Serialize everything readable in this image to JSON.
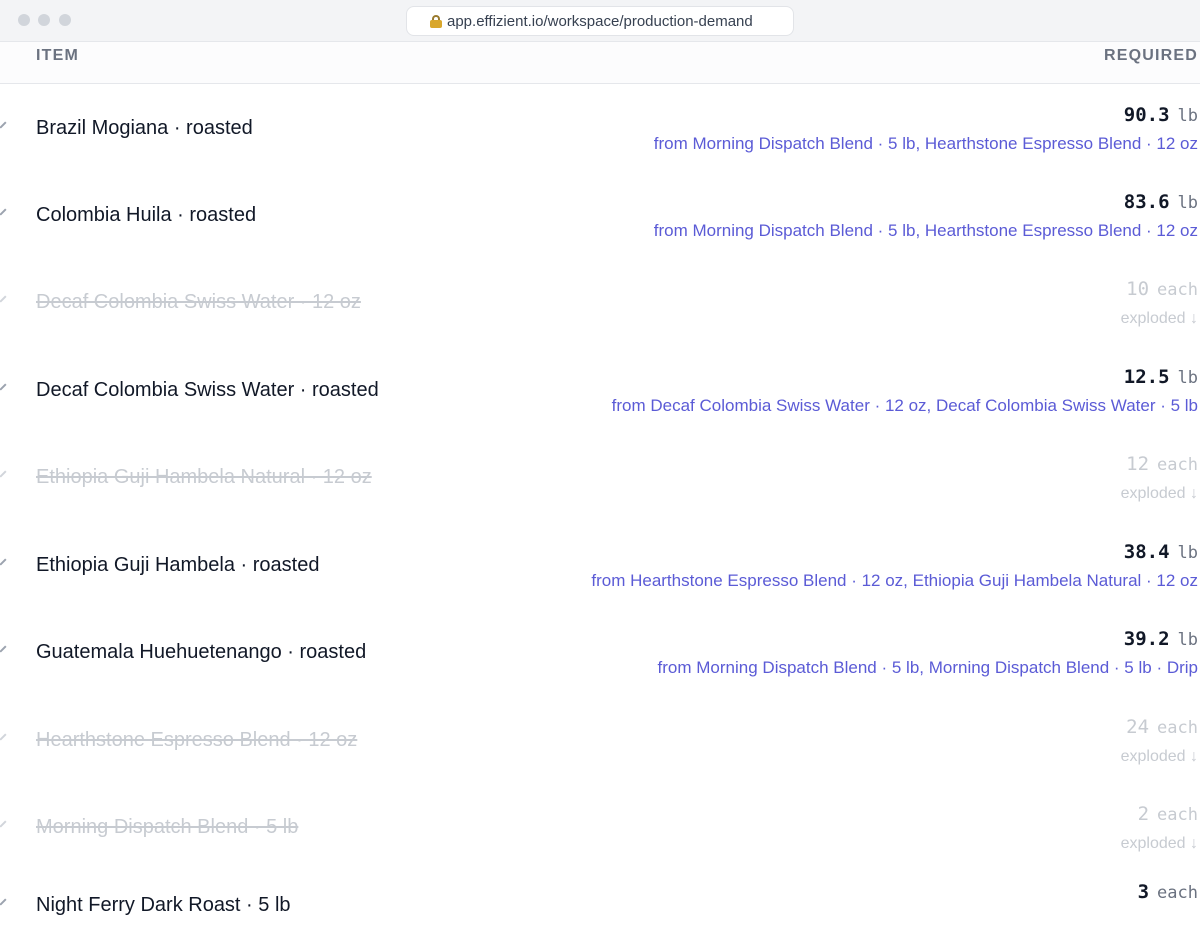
{
  "browser": {
    "url": "app.effizient.io/workspace/production-demand"
  },
  "table": {
    "headers": {
      "item": "ITEM",
      "required": "REQUIRED"
    },
    "rows": [
      {
        "name": "Brazil Mogiana · roasted",
        "qty": "90.3",
        "unit": "lb",
        "muted": false,
        "detail": "from Morning Dispatch Blend · 5 lb, Hearthstone Espresso Blend · 12 oz"
      },
      {
        "name": "Colombia Huila · roasted",
        "qty": "83.6",
        "unit": "lb",
        "muted": false,
        "detail": "from Morning Dispatch Blend · 5 lb, Hearthstone Espresso Blend · 12 oz"
      },
      {
        "name": "Decaf Colombia Swiss Water · 12 oz",
        "qty": "10",
        "unit": "each",
        "muted": true,
        "detail": "exploded ↓"
      },
      {
        "name": "Decaf Colombia Swiss Water · roasted",
        "qty": "12.5",
        "unit": "lb",
        "muted": false,
        "detail": "from Decaf Colombia Swiss Water · 12 oz, Decaf Colombia Swiss Water · 5 lb"
      },
      {
        "name": "Ethiopia Guji Hambela Natural · 12 oz",
        "qty": "12",
        "unit": "each",
        "muted": true,
        "detail": "exploded ↓"
      },
      {
        "name": "Ethiopia Guji Hambela · roasted",
        "qty": "38.4",
        "unit": "lb",
        "muted": false,
        "detail": "from Hearthstone Espresso Blend · 12 oz, Ethiopia Guji Hambela Natural · 12 oz"
      },
      {
        "name": "Guatemala Huehuetenango · roasted",
        "qty": "39.2",
        "unit": "lb",
        "muted": false,
        "detail": "from Morning Dispatch Blend · 5 lb, Morning Dispatch Blend · 5 lb · Drip"
      },
      {
        "name": "Hearthstone Espresso Blend · 12 oz",
        "qty": "24",
        "unit": "each",
        "muted": true,
        "detail": "exploded ↓"
      },
      {
        "name": "Morning Dispatch Blend · 5 lb",
        "qty": "2",
        "unit": "each",
        "muted": true,
        "detail": "exploded ↓"
      },
      {
        "name": "Night Ferry Dark Roast · 5 lb",
        "qty": "3",
        "unit": "each",
        "muted": false,
        "detail": ""
      }
    ]
  }
}
